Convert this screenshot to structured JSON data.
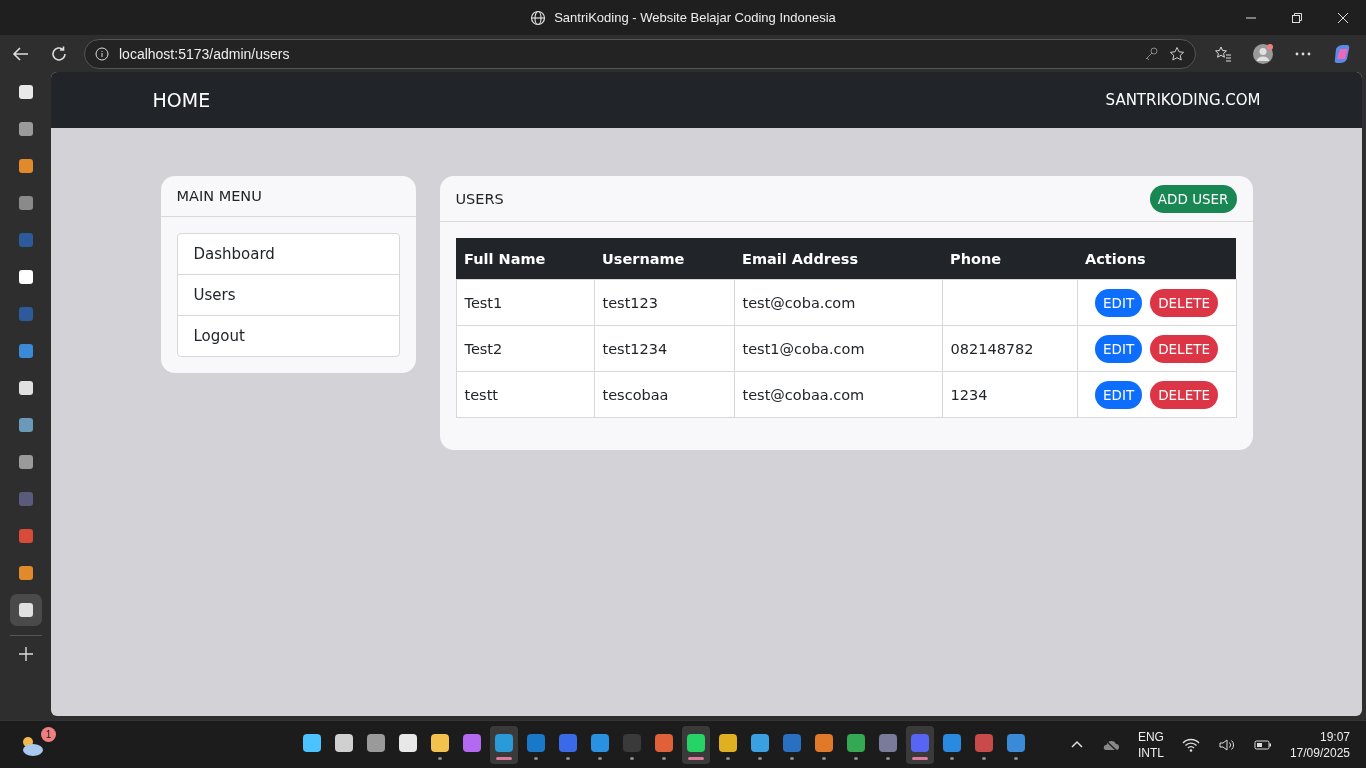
{
  "window": {
    "title": "SantriKoding - Website Belajar Coding Indonesia"
  },
  "browser": {
    "url": "localhost:5173/admin/users"
  },
  "browser_tabs": [
    {
      "color": "#e8e8e8",
      "selected": false
    },
    {
      "color": "#9a9a9a",
      "selected": false
    },
    {
      "color": "#e08a2c",
      "selected": false
    },
    {
      "color": "#8a8a8a",
      "selected": false
    },
    {
      "color": "#2c5a9a",
      "selected": false
    },
    {
      "color": "#ffffff",
      "selected": false
    },
    {
      "color": "#2c5a9a",
      "selected": false
    },
    {
      "color": "#3a8ad8",
      "selected": false
    },
    {
      "color": "#e0e0e0",
      "selected": false
    },
    {
      "color": "#6a9ab8",
      "selected": false
    },
    {
      "color": "#9a9a9a",
      "selected": false
    },
    {
      "color": "#5a5a7a",
      "selected": false
    },
    {
      "color": "#d84a3a",
      "selected": false
    },
    {
      "color": "#e08a2c",
      "selected": false
    },
    {
      "color": "#e0e0e0",
      "selected": true
    }
  ],
  "navbar": {
    "brand": "HOME",
    "link": "SANTRIKODING.COM"
  },
  "menu": {
    "title": "MAIN MENU",
    "items": [
      "Dashboard",
      "Users",
      "Logout"
    ]
  },
  "users": {
    "title": "USERS",
    "add_button": "ADD USER",
    "columns": [
      "Full Name",
      "Username",
      "Email Address",
      "Phone",
      "Actions"
    ],
    "rows": [
      {
        "cells": [
          "Test1",
          "test123",
          "test@coba.com",
          ""
        ],
        "edit": "EDIT",
        "delete": "DELETE"
      },
      {
        "cells": [
          "Test2",
          "test1234",
          "test1@coba.com",
          "082148782"
        ],
        "edit": "EDIT",
        "delete": "DELETE"
      },
      {
        "cells": [
          "testt",
          "tescobaa",
          "test@cobaa.com",
          "1234"
        ],
        "edit": "EDIT",
        "delete": "DELETE"
      }
    ]
  },
  "taskbar": {
    "weather_badge": "1",
    "apps": [
      {
        "color": "#4cc2ff",
        "running": false,
        "selected": false
      },
      {
        "color": "#d0d0d0",
        "running": false,
        "selected": false
      },
      {
        "color": "#9a9a9a",
        "running": false,
        "selected": false
      },
      {
        "color": "#e8e8e8",
        "running": false,
        "selected": false
      },
      {
        "color": "#f2c14e",
        "running": true,
        "selected": false
      },
      {
        "color": "#b46af0",
        "running": false,
        "selected": false
      },
      {
        "color": "#2a9ad8",
        "running": true,
        "selected": true
      },
      {
        "color": "#1a78c8",
        "running": true,
        "selected": false
      },
      {
        "color": "#3a6ae8",
        "running": true,
        "selected": false
      },
      {
        "color": "#2a90e0",
        "running": true,
        "selected": false
      },
      {
        "color": "#3a3a3a",
        "running": true,
        "selected": false
      },
      {
        "color": "#e0603a",
        "running": true,
        "selected": false
      },
      {
        "color": "#25d366",
        "running": true,
        "selected": true
      },
      {
        "color": "#e0b020",
        "running": true,
        "selected": false
      },
      {
        "color": "#3aa0e0",
        "running": true,
        "selected": false
      },
      {
        "color": "#2a70c0",
        "running": true,
        "selected": false
      },
      {
        "color": "#e07a2a",
        "running": true,
        "selected": false
      },
      {
        "color": "#34a853",
        "running": true,
        "selected": false
      },
      {
        "color": "#7a7a9a",
        "running": true,
        "selected": false
      },
      {
        "color": "#5865f2",
        "running": true,
        "selected": true
      },
      {
        "color": "#2a8ae0",
        "running": true,
        "selected": false
      },
      {
        "color": "#c84a4a",
        "running": true,
        "selected": false
      },
      {
        "color": "#3a8ad8",
        "running": true,
        "selected": false
      }
    ],
    "language": "ENG",
    "layout": "INTL",
    "time": "19:07",
    "date": "17/09/2025"
  }
}
